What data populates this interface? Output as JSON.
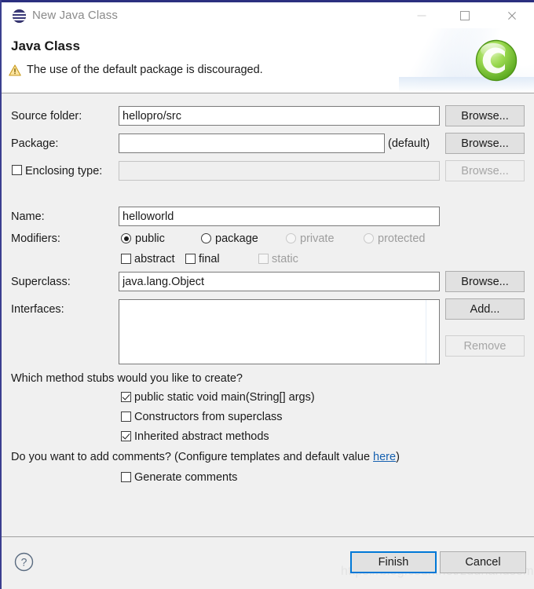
{
  "window": {
    "title": "New Java Class",
    "icon": "eclipse-sphere-icon",
    "controls": {
      "minimize": "minimize-icon",
      "maximize": "maximize-icon",
      "close": "close-icon"
    }
  },
  "banner": {
    "heading": "Java Class",
    "message": "The use of the default package is discouraged.",
    "warning_icon": "warning-triangle-icon",
    "badge_icon": "green-c-circle-icon",
    "warning_color": "#f0c419",
    "badge_color": "#7ac943"
  },
  "form": {
    "source_folder": {
      "label": "Source folder:",
      "value": "hellopro/src",
      "browse": "Browse..."
    },
    "package": {
      "label": "Package:",
      "value": "",
      "default_note": "(default)",
      "browse": "Browse..."
    },
    "enclosing_type": {
      "label": "Enclosing type:",
      "checked": false,
      "value": "",
      "browse": "Browse...",
      "disabled": true
    },
    "name": {
      "label": "Name:",
      "value": "helloworld"
    },
    "modifiers": {
      "label": "Modifiers:",
      "access": [
        {
          "label": "public",
          "selected": true,
          "disabled": false
        },
        {
          "label": "package",
          "selected": false,
          "disabled": false
        },
        {
          "label": "private",
          "selected": false,
          "disabled": true
        },
        {
          "label": "protected",
          "selected": false,
          "disabled": true
        }
      ],
      "flags": [
        {
          "label": "abstract",
          "checked": false,
          "disabled": false
        },
        {
          "label": "final",
          "checked": false,
          "disabled": false
        },
        {
          "label": "static",
          "checked": false,
          "disabled": true
        }
      ]
    },
    "superclass": {
      "label": "Superclass:",
      "value": "java.lang.Object",
      "browse": "Browse..."
    },
    "interfaces": {
      "label": "Interfaces:",
      "items": [],
      "add": "Add...",
      "remove": "Remove",
      "remove_disabled": true
    }
  },
  "stubs": {
    "question": "Which method stubs would you like to create?",
    "options": [
      {
        "label": "public static void main(String[] args)",
        "checked": true
      },
      {
        "label": "Constructors from superclass",
        "checked": false
      },
      {
        "label": "Inherited abstract methods",
        "checked": true
      }
    ]
  },
  "comments": {
    "question_prefix": "Do you want to add comments? (Configure templates and default value ",
    "link": "here",
    "question_suffix": ")",
    "option": {
      "label": "Generate comments",
      "checked": false
    }
  },
  "footer": {
    "help_icon": "help-question-icon",
    "finish": "Finish",
    "cancel": "Cancel",
    "focus_color": "#0078d7"
  },
  "watermark": "https://blog.csdn.net/zddhandsome"
}
